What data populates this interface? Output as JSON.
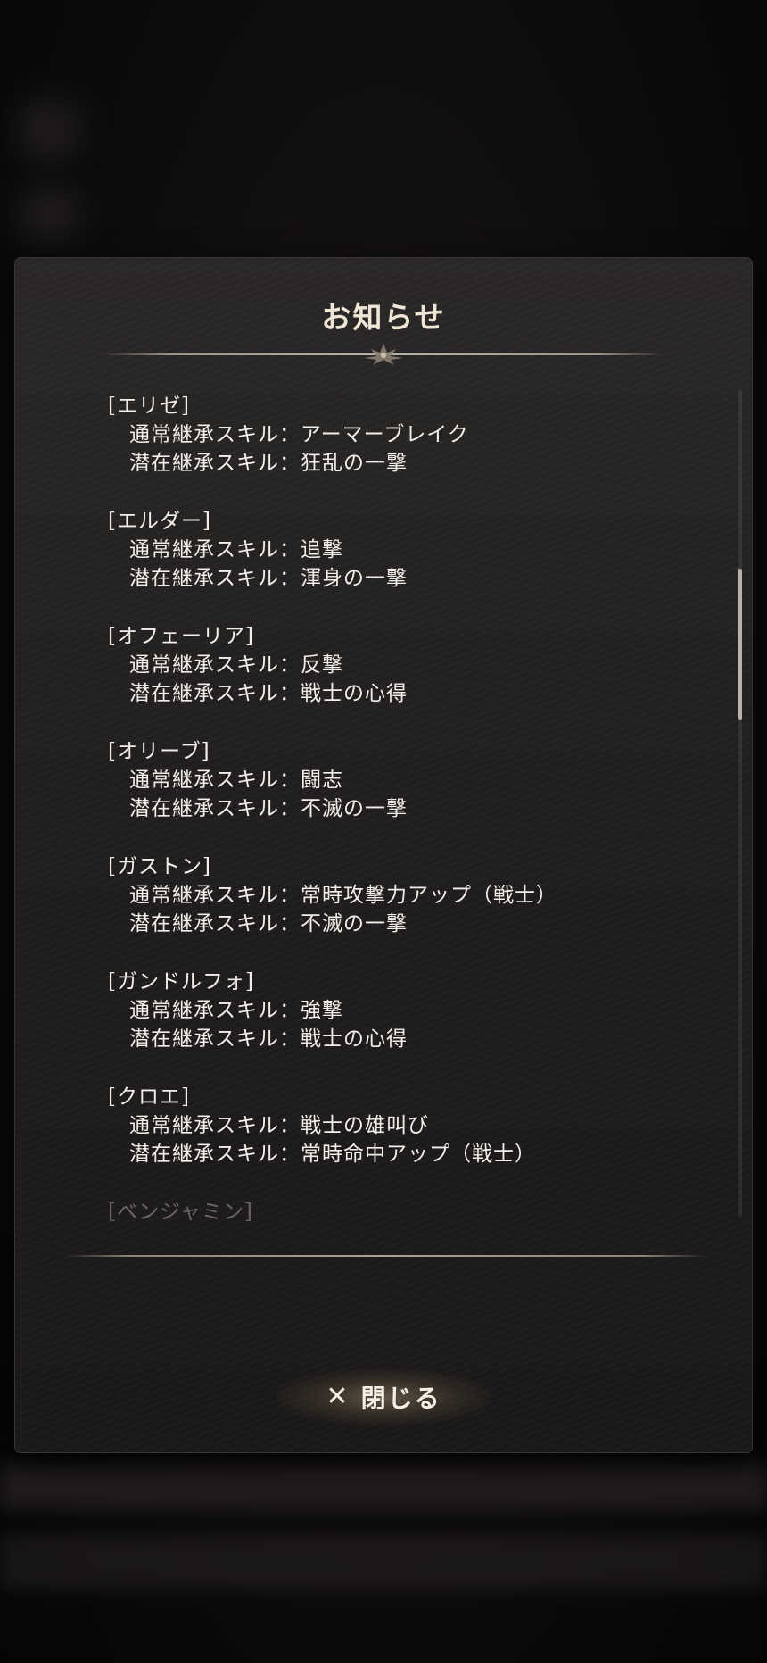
{
  "dialog": {
    "title": "お知らせ",
    "close_label": "閉じる",
    "close_icon": "close-icon",
    "entries": [
      {
        "name": "[エリゼ]",
        "normal_skill": "通常継承スキル：アーマーブレイク",
        "latent_skill": "潜在継承スキル：狂乱の一撃"
      },
      {
        "name": "[エルダー]",
        "normal_skill": "通常継承スキル：追撃",
        "latent_skill": "潜在継承スキル：渾身の一撃"
      },
      {
        "name": "[オフェーリア]",
        "normal_skill": "通常継承スキル：反撃",
        "latent_skill": "潜在継承スキル：戦士の心得"
      },
      {
        "name": "[オリーブ]",
        "normal_skill": "通常継承スキル：闘志",
        "latent_skill": "潜在継承スキル：不滅の一撃"
      },
      {
        "name": "[ガストン]",
        "normal_skill": "通常継承スキル：常時攻撃力アップ（戦士）",
        "latent_skill": "潜在継承スキル：不滅の一撃"
      },
      {
        "name": "[ガンドルフォ]",
        "normal_skill": "通常継承スキル：強撃",
        "latent_skill": "潜在継承スキル：戦士の心得"
      },
      {
        "name": "[クロエ]",
        "normal_skill": "通常継承スキル：戦士の雄叫び",
        "latent_skill": "潜在継承スキル：常時命中アップ（戦士）"
      }
    ],
    "partial_entry": "[ベンジャミン]"
  },
  "colors": {
    "text": "#f2eee8",
    "title": "#efe6d6",
    "panel": "#1f1d1d"
  }
}
